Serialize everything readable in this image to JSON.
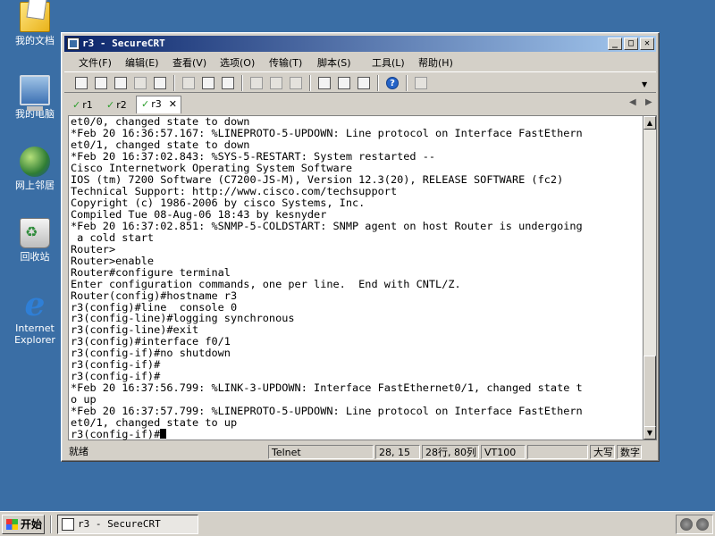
{
  "desktop": {
    "icons": [
      {
        "label": "我的文档",
        "icon": "my-documents-icon"
      },
      {
        "label": "我的电脑",
        "icon": "my-computer-icon"
      },
      {
        "label": "网上邻居",
        "icon": "network-places-icon"
      },
      {
        "label": "回收站",
        "icon": "recycle-bin-icon"
      },
      {
        "label": "Internet Explorer",
        "icon": "internet-explorer-icon"
      }
    ]
  },
  "window": {
    "title": "r3 - SecureCRT",
    "menu": [
      "文件(F)",
      "编辑(E)",
      "查看(V)",
      "选项(O)",
      "传输(T)",
      "脚本(S)",
      "工具(L)",
      "帮助(H)"
    ],
    "tabs": [
      {
        "label": "r1"
      },
      {
        "label": "r2"
      },
      {
        "label": "r3",
        "close": "✕"
      }
    ],
    "terminal_lines": [
      "et0/0, changed state to down",
      "*Feb 20 16:36:57.167: %LINEPROTO-5-UPDOWN: Line protocol on Interface FastEthern",
      "et0/1, changed state to down",
      "*Feb 20 16:37:02.843: %SYS-5-RESTART: System restarted --",
      "Cisco Internetwork Operating System Software",
      "IOS (tm) 7200 Software (C7200-JS-M), Version 12.3(20), RELEASE SOFTWARE (fc2)",
      "Technical Support: http://www.cisco.com/techsupport",
      "Copyright (c) 1986-2006 by cisco Systems, Inc.",
      "Compiled Tue 08-Aug-06 18:43 by kesnyder",
      "*Feb 20 16:37:02.851: %SNMP-5-COLDSTART: SNMP agent on host Router is undergoing",
      " a cold start",
      "Router>",
      "Router>enable",
      "Router#configure terminal",
      "Enter configuration commands, one per line.  End with CNTL/Z.",
      "Router(config)#hostname r3",
      "r3(config)#line  console 0",
      "r3(config-line)#logging synchronous",
      "r3(config-line)#exit",
      "r3(config)#interface f0/1",
      "r3(config-if)#no shutdown",
      "r3(config-if)#",
      "r3(config-if)#",
      "*Feb 20 16:37:56.799: %LINK-3-UPDOWN: Interface FastEthernet0/1, changed state t",
      "o up",
      "*Feb 20 16:37:57.799: %LINEPROTO-5-UPDOWN: Line protocol on Interface FastEthern",
      "et0/1, changed state to up"
    ],
    "prompt": "r3(config-if)#",
    "status": {
      "ready": "就绪",
      "protocol": "Telnet",
      "cursor_pos": "28, 15",
      "size": "28行, 80列",
      "emulation": "VT100",
      "caps": "大写",
      "num": "数字"
    }
  },
  "taskbar": {
    "start_label": "开始",
    "task_label": "r3 - SecureCRT"
  }
}
